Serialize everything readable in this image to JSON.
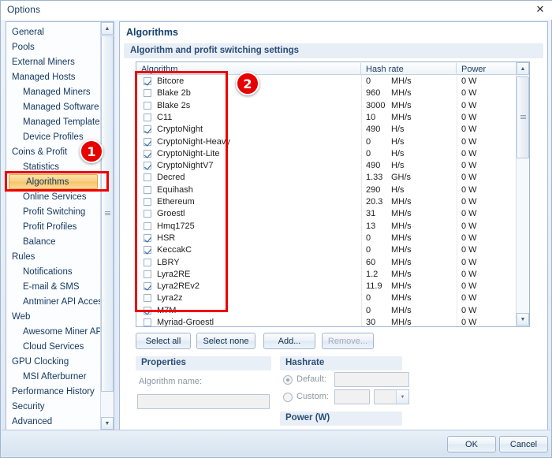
{
  "window": {
    "title": "Options",
    "close_icon": "close-icon"
  },
  "sidebar": {
    "items": [
      {
        "label": "General",
        "level": 0,
        "selected": false
      },
      {
        "label": "Pools",
        "level": 0,
        "selected": false
      },
      {
        "label": "External Miners",
        "level": 0,
        "selected": false
      },
      {
        "label": "Managed Hosts",
        "level": 0,
        "selected": false
      },
      {
        "label": "Managed Miners",
        "level": 1,
        "selected": false
      },
      {
        "label": "Managed Software",
        "level": 1,
        "selected": false
      },
      {
        "label": "Managed Templates",
        "level": 1,
        "selected": false
      },
      {
        "label": "Device Profiles",
        "level": 1,
        "selected": false
      },
      {
        "label": "Coins & Profit",
        "level": 0,
        "selected": false
      },
      {
        "label": "Statistics",
        "level": 1,
        "selected": false
      },
      {
        "label": "Algorithms",
        "level": 1,
        "selected": true
      },
      {
        "label": "Online Services",
        "level": 1,
        "selected": false
      },
      {
        "label": "Profit Switching",
        "level": 1,
        "selected": false
      },
      {
        "label": "Profit Profiles",
        "level": 1,
        "selected": false
      },
      {
        "label": "Balance",
        "level": 1,
        "selected": false
      },
      {
        "label": "Rules",
        "level": 0,
        "selected": false
      },
      {
        "label": "Notifications",
        "level": 1,
        "selected": false
      },
      {
        "label": "E-mail & SMS",
        "level": 1,
        "selected": false
      },
      {
        "label": "Antminer API Access",
        "level": 1,
        "selected": false
      },
      {
        "label": "Web",
        "level": 0,
        "selected": false
      },
      {
        "label": "Awesome Miner API",
        "level": 1,
        "selected": false
      },
      {
        "label": "Cloud Services",
        "level": 1,
        "selected": false
      },
      {
        "label": "GPU Clocking",
        "level": 0,
        "selected": false
      },
      {
        "label": "MSI Afterburner",
        "level": 1,
        "selected": false
      },
      {
        "label": "Performance History",
        "level": 0,
        "selected": false
      },
      {
        "label": "Security",
        "level": 0,
        "selected": false
      },
      {
        "label": "Advanced",
        "level": 0,
        "selected": false
      }
    ],
    "scrollbar": {
      "up_arrow_icon": "triangle-up-icon",
      "down_arrow_icon": "triangle-down-icon"
    }
  },
  "main": {
    "title": "Algorithms",
    "section_header": "Algorithm and profit switching settings",
    "columns": [
      "Algorithm",
      "Hash rate",
      "Power"
    ],
    "rows": [
      {
        "checked": true,
        "name": "Bitcore",
        "hash": "0",
        "unit": "MH/s",
        "power": "0 W"
      },
      {
        "checked": false,
        "name": "Blake 2b",
        "hash": "960",
        "unit": "MH/s",
        "power": "0 W"
      },
      {
        "checked": false,
        "name": "Blake 2s",
        "hash": "3000",
        "unit": "MH/s",
        "power": "0 W"
      },
      {
        "checked": false,
        "name": "C11",
        "hash": "10",
        "unit": "MH/s",
        "power": "0 W"
      },
      {
        "checked": true,
        "name": "CryptoNight",
        "hash": "490",
        "unit": "H/s",
        "power": "0 W"
      },
      {
        "checked": true,
        "name": "CryptoNight-Heavy",
        "hash": "0",
        "unit": "H/s",
        "power": "0 W"
      },
      {
        "checked": true,
        "name": "CryptoNight-Lite",
        "hash": "0",
        "unit": "H/s",
        "power": "0 W"
      },
      {
        "checked": true,
        "name": "CryptoNightV7",
        "hash": "490",
        "unit": "H/s",
        "power": "0 W"
      },
      {
        "checked": false,
        "name": "Decred",
        "hash": "1.33",
        "unit": "GH/s",
        "power": "0 W"
      },
      {
        "checked": false,
        "name": "Equihash",
        "hash": "290",
        "unit": "H/s",
        "power": "0 W"
      },
      {
        "checked": false,
        "name": "Ethereum",
        "hash": "20.3",
        "unit": "MH/s",
        "power": "0 W"
      },
      {
        "checked": false,
        "name": "Groestl",
        "hash": "31",
        "unit": "MH/s",
        "power": "0 W"
      },
      {
        "checked": false,
        "name": "Hmq1725",
        "hash": "13",
        "unit": "MH/s",
        "power": "0 W"
      },
      {
        "checked": true,
        "name": "HSR",
        "hash": "0",
        "unit": "MH/s",
        "power": "0 W"
      },
      {
        "checked": true,
        "name": "KeccakC",
        "hash": "0",
        "unit": "MH/s",
        "power": "0 W"
      },
      {
        "checked": false,
        "name": "LBRY",
        "hash": "60",
        "unit": "MH/s",
        "power": "0 W"
      },
      {
        "checked": false,
        "name": "Lyra2RE",
        "hash": "1.2",
        "unit": "MH/s",
        "power": "0 W"
      },
      {
        "checked": true,
        "name": "Lyra2REv2",
        "hash": "11.9",
        "unit": "MH/s",
        "power": "0 W"
      },
      {
        "checked": false,
        "name": "Lyra2z",
        "hash": "0",
        "unit": "MH/s",
        "power": "0 W"
      },
      {
        "checked": true,
        "name": "M7M",
        "hash": "0",
        "unit": "MH/s",
        "power": "0 W"
      },
      {
        "checked": false,
        "name": "Myriad-Groestl",
        "hash": "30",
        "unit": "MH/s",
        "power": "0 W"
      }
    ],
    "list_scrollbar": {
      "up_arrow_icon": "triangle-up-icon",
      "down_arrow_icon": "triangle-down-icon"
    },
    "buttons": {
      "select_all": "Select all",
      "select_none": "Select none",
      "add": "Add...",
      "remove": "Remove..."
    },
    "properties": {
      "group_label": "Properties",
      "algorithm_name_label": "Algorithm name:",
      "algorithm_name_value": ""
    },
    "hashrate": {
      "group_label": "Hashrate",
      "default_label": "Default:",
      "default_selected": true,
      "default_value": "",
      "custom_label": "Custom:",
      "custom_selected": false,
      "custom_value": "",
      "custom_unit": "",
      "dropdown_icon": "chevron-down-icon"
    },
    "power": {
      "group_label": "Power (W)",
      "value": ""
    }
  },
  "footer": {
    "ok": "OK",
    "cancel": "Cancel"
  },
  "annotations": [
    {
      "id": "1",
      "label": "1"
    },
    {
      "id": "2",
      "label": "2"
    }
  ]
}
